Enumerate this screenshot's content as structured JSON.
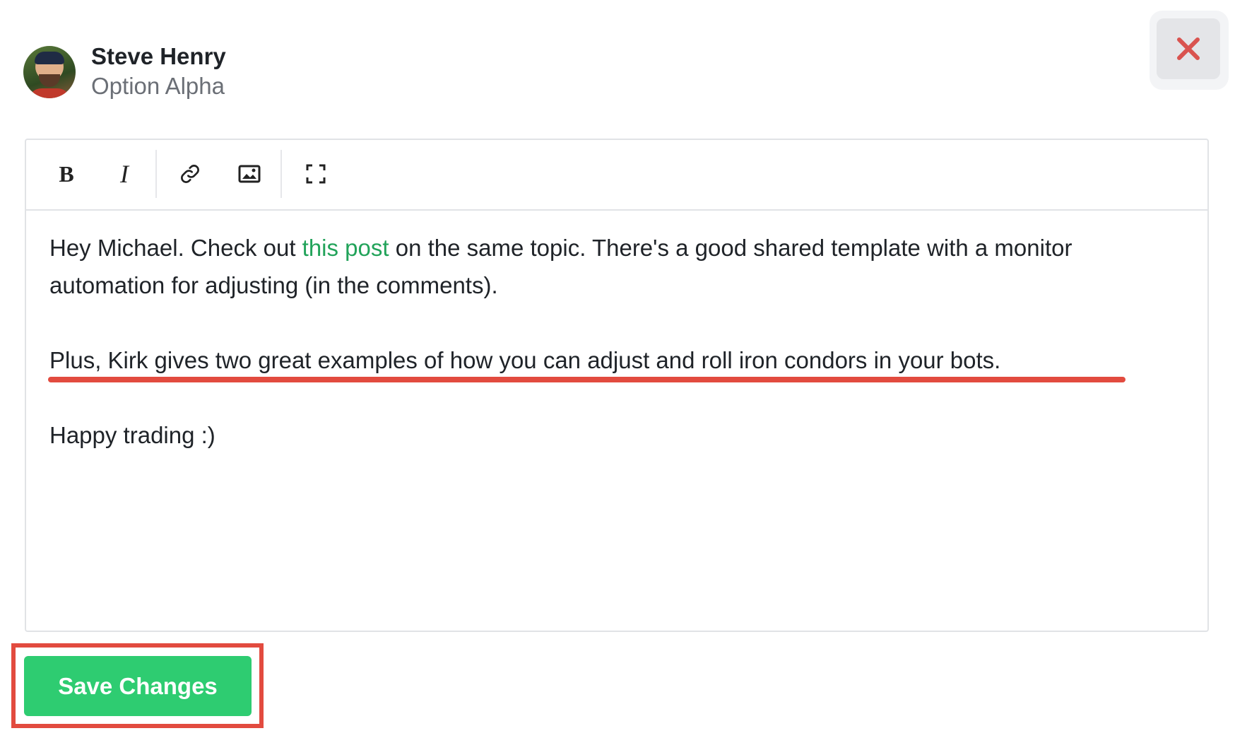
{
  "user": {
    "name": "Steve Henry",
    "organization": "Option Alpha"
  },
  "close_button": {
    "icon": "close-icon",
    "color": "#d9534f"
  },
  "toolbar": {
    "bold_label": "B",
    "italic_label": "I",
    "buttons": [
      "bold-icon",
      "italic-icon",
      "link-icon",
      "image-icon",
      "fullscreen-icon"
    ]
  },
  "editor": {
    "paragraph1": {
      "before_link": "Hey Michael. Check out ",
      "link_text": "this post",
      "after_link": " on the same topic. There's a good shared template with a monitor automation for adjusting (in the comments)."
    },
    "paragraph2": "Plus, Kirk gives two great examples of how you can adjust and roll iron condors in your bots.",
    "paragraph3": "Happy trading :)"
  },
  "footer": {
    "save_label": "Save Changes"
  },
  "colors": {
    "accent_green": "#2ecc71",
    "link_green": "#22a35a",
    "annotation_red": "#e24b3f"
  }
}
